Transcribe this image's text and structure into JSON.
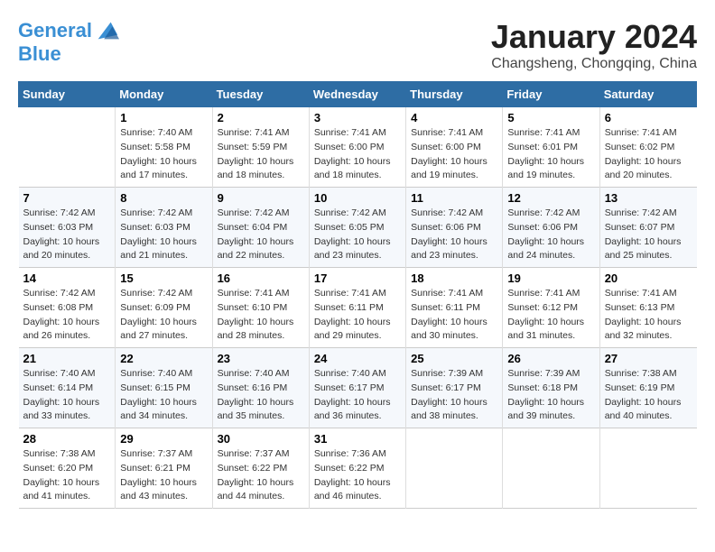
{
  "header": {
    "logo_line1": "General",
    "logo_line2": "Blue",
    "month": "January 2024",
    "location": "Changsheng, Chongqing, China"
  },
  "weekdays": [
    "Sunday",
    "Monday",
    "Tuesday",
    "Wednesday",
    "Thursday",
    "Friday",
    "Saturday"
  ],
  "weeks": [
    [
      {
        "day": "",
        "info": ""
      },
      {
        "day": "1",
        "info": "Sunrise: 7:40 AM\nSunset: 5:58 PM\nDaylight: 10 hours\nand 17 minutes."
      },
      {
        "day": "2",
        "info": "Sunrise: 7:41 AM\nSunset: 5:59 PM\nDaylight: 10 hours\nand 18 minutes."
      },
      {
        "day": "3",
        "info": "Sunrise: 7:41 AM\nSunset: 6:00 PM\nDaylight: 10 hours\nand 18 minutes."
      },
      {
        "day": "4",
        "info": "Sunrise: 7:41 AM\nSunset: 6:00 PM\nDaylight: 10 hours\nand 19 minutes."
      },
      {
        "day": "5",
        "info": "Sunrise: 7:41 AM\nSunset: 6:01 PM\nDaylight: 10 hours\nand 19 minutes."
      },
      {
        "day": "6",
        "info": "Sunrise: 7:41 AM\nSunset: 6:02 PM\nDaylight: 10 hours\nand 20 minutes."
      }
    ],
    [
      {
        "day": "7",
        "info": "Sunrise: 7:42 AM\nSunset: 6:03 PM\nDaylight: 10 hours\nand 20 minutes."
      },
      {
        "day": "8",
        "info": "Sunrise: 7:42 AM\nSunset: 6:03 PM\nDaylight: 10 hours\nand 21 minutes."
      },
      {
        "day": "9",
        "info": "Sunrise: 7:42 AM\nSunset: 6:04 PM\nDaylight: 10 hours\nand 22 minutes."
      },
      {
        "day": "10",
        "info": "Sunrise: 7:42 AM\nSunset: 6:05 PM\nDaylight: 10 hours\nand 23 minutes."
      },
      {
        "day": "11",
        "info": "Sunrise: 7:42 AM\nSunset: 6:06 PM\nDaylight: 10 hours\nand 23 minutes."
      },
      {
        "day": "12",
        "info": "Sunrise: 7:42 AM\nSunset: 6:06 PM\nDaylight: 10 hours\nand 24 minutes."
      },
      {
        "day": "13",
        "info": "Sunrise: 7:42 AM\nSunset: 6:07 PM\nDaylight: 10 hours\nand 25 minutes."
      }
    ],
    [
      {
        "day": "14",
        "info": "Sunrise: 7:42 AM\nSunset: 6:08 PM\nDaylight: 10 hours\nand 26 minutes."
      },
      {
        "day": "15",
        "info": "Sunrise: 7:42 AM\nSunset: 6:09 PM\nDaylight: 10 hours\nand 27 minutes."
      },
      {
        "day": "16",
        "info": "Sunrise: 7:41 AM\nSunset: 6:10 PM\nDaylight: 10 hours\nand 28 minutes."
      },
      {
        "day": "17",
        "info": "Sunrise: 7:41 AM\nSunset: 6:11 PM\nDaylight: 10 hours\nand 29 minutes."
      },
      {
        "day": "18",
        "info": "Sunrise: 7:41 AM\nSunset: 6:11 PM\nDaylight: 10 hours\nand 30 minutes."
      },
      {
        "day": "19",
        "info": "Sunrise: 7:41 AM\nSunset: 6:12 PM\nDaylight: 10 hours\nand 31 minutes."
      },
      {
        "day": "20",
        "info": "Sunrise: 7:41 AM\nSunset: 6:13 PM\nDaylight: 10 hours\nand 32 minutes."
      }
    ],
    [
      {
        "day": "21",
        "info": "Sunrise: 7:40 AM\nSunset: 6:14 PM\nDaylight: 10 hours\nand 33 minutes."
      },
      {
        "day": "22",
        "info": "Sunrise: 7:40 AM\nSunset: 6:15 PM\nDaylight: 10 hours\nand 34 minutes."
      },
      {
        "day": "23",
        "info": "Sunrise: 7:40 AM\nSunset: 6:16 PM\nDaylight: 10 hours\nand 35 minutes."
      },
      {
        "day": "24",
        "info": "Sunrise: 7:40 AM\nSunset: 6:17 PM\nDaylight: 10 hours\nand 36 minutes."
      },
      {
        "day": "25",
        "info": "Sunrise: 7:39 AM\nSunset: 6:17 PM\nDaylight: 10 hours\nand 38 minutes."
      },
      {
        "day": "26",
        "info": "Sunrise: 7:39 AM\nSunset: 6:18 PM\nDaylight: 10 hours\nand 39 minutes."
      },
      {
        "day": "27",
        "info": "Sunrise: 7:38 AM\nSunset: 6:19 PM\nDaylight: 10 hours\nand 40 minutes."
      }
    ],
    [
      {
        "day": "28",
        "info": "Sunrise: 7:38 AM\nSunset: 6:20 PM\nDaylight: 10 hours\nand 41 minutes."
      },
      {
        "day": "29",
        "info": "Sunrise: 7:37 AM\nSunset: 6:21 PM\nDaylight: 10 hours\nand 43 minutes."
      },
      {
        "day": "30",
        "info": "Sunrise: 7:37 AM\nSunset: 6:22 PM\nDaylight: 10 hours\nand 44 minutes."
      },
      {
        "day": "31",
        "info": "Sunrise: 7:36 AM\nSunset: 6:22 PM\nDaylight: 10 hours\nand 46 minutes."
      },
      {
        "day": "",
        "info": ""
      },
      {
        "day": "",
        "info": ""
      },
      {
        "day": "",
        "info": ""
      }
    ]
  ]
}
